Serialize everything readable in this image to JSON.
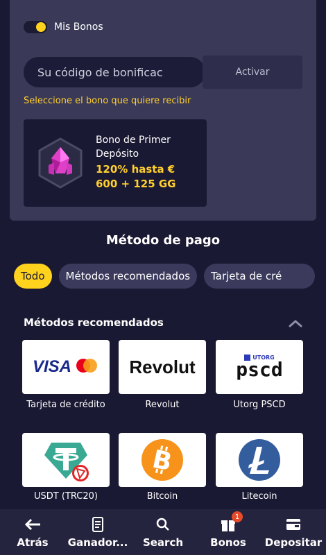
{
  "bonus": {
    "toggle_label": "Mis Bonos",
    "toggle_on": true,
    "code_placeholder": "Su código de bonificac",
    "activate_label": "Activar",
    "select_hint": "Seleccione el bono que quiere recibir",
    "card": {
      "title": "Bono de Primer Depósito",
      "amount": "120% hasta € 600 + 125 GG",
      "icon": "pink-crystal-hexagon-icon"
    }
  },
  "payment": {
    "title": "Método de pago",
    "filters": [
      "Todo",
      "Métodos recomendados",
      "Tarjeta de cré"
    ],
    "active_filter": "Todo",
    "recommended_title": "Métodos recomendados",
    "methods": [
      {
        "label": "Tarjeta de crédito",
        "logo": "visa-mastercard-logo"
      },
      {
        "label": "Revolut",
        "logo": "revolut-logo",
        "logo_text": "Revolut"
      },
      {
        "label": "Utorg PSCD",
        "logo": "utorg-pscd-logo",
        "logo_small": "UTORG",
        "logo_text": "pscd"
      },
      {
        "label": "USDT (TRC20)",
        "logo": "tether-tron-logo"
      },
      {
        "label": "Bitcoin",
        "logo": "bitcoin-logo"
      },
      {
        "label": "Litecoin",
        "logo": "litecoin-logo"
      }
    ],
    "visa_text": "VISA",
    "mastercard_text": "mastercard"
  },
  "nav": {
    "items": [
      {
        "label": "Atrás",
        "icon": "arrow-left-icon"
      },
      {
        "label": "Ganador...",
        "icon": "scroll-icon"
      },
      {
        "label": "Search",
        "icon": "search-icon"
      },
      {
        "label": "Bonos",
        "icon": "gift-icon",
        "badge": "1"
      },
      {
        "label": "Depositar",
        "icon": "wallet-icon"
      }
    ]
  },
  "colors": {
    "background": "#1a1933",
    "panel": "#3a3958",
    "accent": "#ffd21e",
    "highlight_text": "#ffcf2e"
  }
}
